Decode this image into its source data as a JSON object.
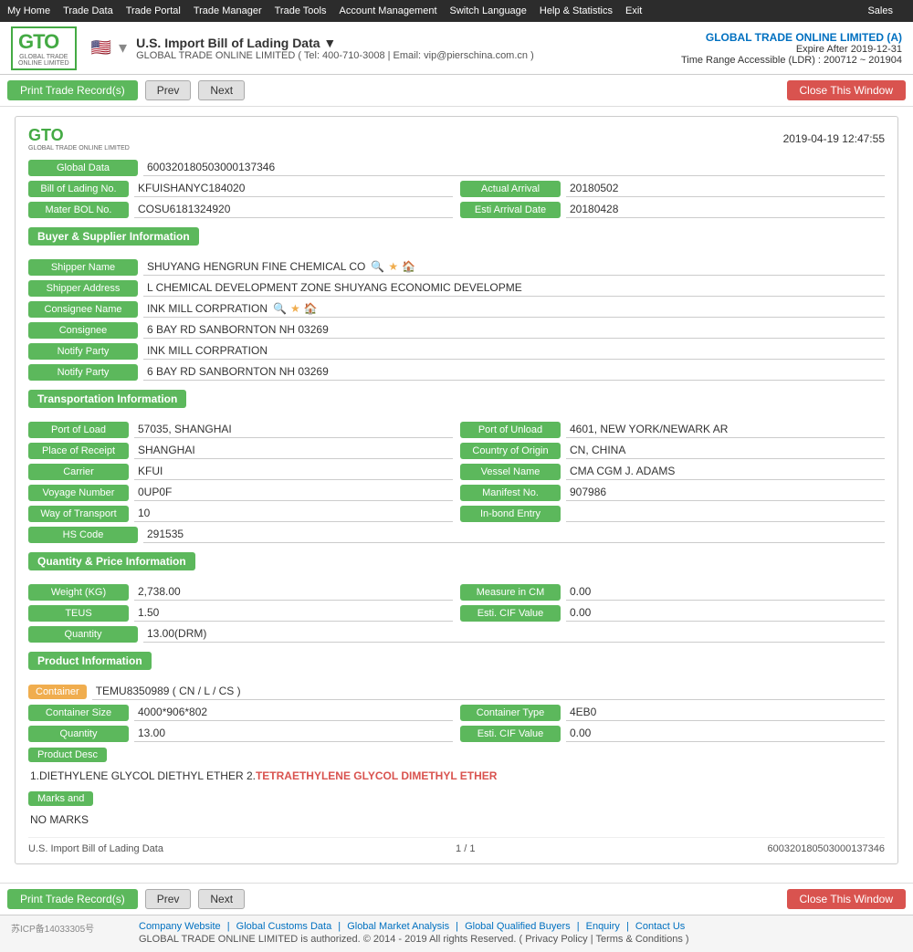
{
  "nav": {
    "items": [
      "My Home",
      "Trade Data",
      "Trade Portal",
      "Trade Manager",
      "Trade Tools",
      "Account Management",
      "Switch Language",
      "Help & Statistics",
      "Exit",
      "Sales"
    ]
  },
  "header": {
    "logo_text": "GTO",
    "logo_sub": "GLOBAL TRADE\nONLINE LIMITED",
    "flag_emoji": "🇺🇸",
    "title": "U.S. Import Bill of Lading Data ▼",
    "sub": "GLOBAL TRADE ONLINE LIMITED ( Tel: 400-710-3008 | Email: vip@pierschina.com.cn )",
    "company": "GLOBAL TRADE ONLINE LIMITED (A)",
    "expire": "Expire After 2019-12-31",
    "time_range": "Time Range Accessible (LDR) : 200712 ~ 201904"
  },
  "toolbar": {
    "print_label": "Print Trade Record(s)",
    "prev_label": "Prev",
    "next_label": "Next",
    "close_label": "Close This Window"
  },
  "record": {
    "datetime": "2019-04-19 12:47:55",
    "global_data_label": "Global Data",
    "global_data_value": "600320180503000137346",
    "bol_label": "Bill of Lading No.",
    "bol_value": "KFUISHANYC184020",
    "actual_arrival_label": "Actual Arrival",
    "actual_arrival_value": "20180502",
    "mater_bol_label": "Mater BOL No.",
    "mater_bol_value": "COSU6181324920",
    "esti_arrival_label": "Esti Arrival Date",
    "esti_arrival_value": "20180428",
    "buyer_supplier_section": "Buyer & Supplier Information",
    "shipper_name_label": "Shipper Name",
    "shipper_name_value": "SHUYANG HENGRUN FINE CHEMICAL CO",
    "shipper_address_label": "Shipper Address",
    "shipper_address_value": "L CHEMICAL DEVELOPMENT ZONE SHUYANG ECONOMIC DEVELOPME",
    "consignee_name_label": "Consignee Name",
    "consignee_name_value": "INK MILL CORPRATION",
    "consignee_label": "Consignee",
    "consignee_value": "6 BAY RD SANBORNTON NH 03269",
    "notify_party_label": "Notify Party",
    "notify_party_value": "INK MILL CORPRATION",
    "notify_party2_label": "Notify Party",
    "notify_party2_value": "6 BAY RD SANBORNTON NH 03269",
    "transport_section": "Transportation Information",
    "port_of_load_label": "Port of Load",
    "port_of_load_value": "57035, SHANGHAI",
    "port_of_unload_label": "Port of Unload",
    "port_of_unload_value": "4601, NEW YORK/NEWARK AR",
    "place_of_receipt_label": "Place of Receipt",
    "place_of_receipt_value": "SHANGHAI",
    "country_of_origin_label": "Country of Origin",
    "country_of_origin_value": "CN, CHINA",
    "carrier_label": "Carrier",
    "carrier_value": "KFUI",
    "vessel_name_label": "Vessel Name",
    "vessel_name_value": "CMA CGM J. ADAMS",
    "voyage_number_label": "Voyage Number",
    "voyage_number_value": "0UP0F",
    "manifest_no_label": "Manifest No.",
    "manifest_no_value": "907986",
    "way_of_transport_label": "Way of Transport",
    "way_of_transport_value": "10",
    "in_bond_entry_label": "In-bond Entry",
    "in_bond_entry_value": "",
    "hs_code_label": "HS Code",
    "hs_code_value": "291535",
    "quantity_section": "Quantity & Price Information",
    "weight_label": "Weight (KG)",
    "weight_value": "2,738.00",
    "measure_cm_label": "Measure in CM",
    "measure_cm_value": "0.00",
    "teus_label": "TEUS",
    "teus_value": "1.50",
    "esti_cif_label": "Esti. CIF Value",
    "esti_cif_value": "0.00",
    "quantity_label": "Quantity",
    "quantity_value": "13.00(DRM)",
    "product_section": "Product Information",
    "container_label": "Container",
    "container_value": "TEMU8350989 ( CN / L / CS )",
    "container_size_label": "Container Size",
    "container_size_value": "4000*906*802",
    "container_type_label": "Container Type",
    "container_type_value": "4EB0",
    "quantity2_label": "Quantity",
    "quantity2_value": "13.00",
    "esti_cif2_label": "Esti. CIF Value",
    "esti_cif2_value": "0.00",
    "product_desc_label": "Product Desc",
    "product_desc_text": "1.DIETHYLENE GLYCOL DIETHYL ETHER 2.TETRAETHYLENE GLYCOL DIMETHYL ETHER",
    "marks_label": "Marks and",
    "marks_value": "NO MARKS",
    "footer_left": "U.S. Import Bill of Lading Data",
    "footer_page": "1 / 1",
    "footer_id": "600320180503000137346"
  },
  "footer": {
    "icp": "苏ICP备14033305号",
    "links_row1": [
      "Company Website",
      "Global Customs Data",
      "Global Market Analysis",
      "Global Qualified Buyers",
      "Enquiry",
      "Contact Us"
    ],
    "copyright": "GLOBAL TRADE ONLINE LIMITED is authorized. © 2014 - 2019 All rights Reserved.  ( Privacy Policy | Terms & Conditions )"
  }
}
